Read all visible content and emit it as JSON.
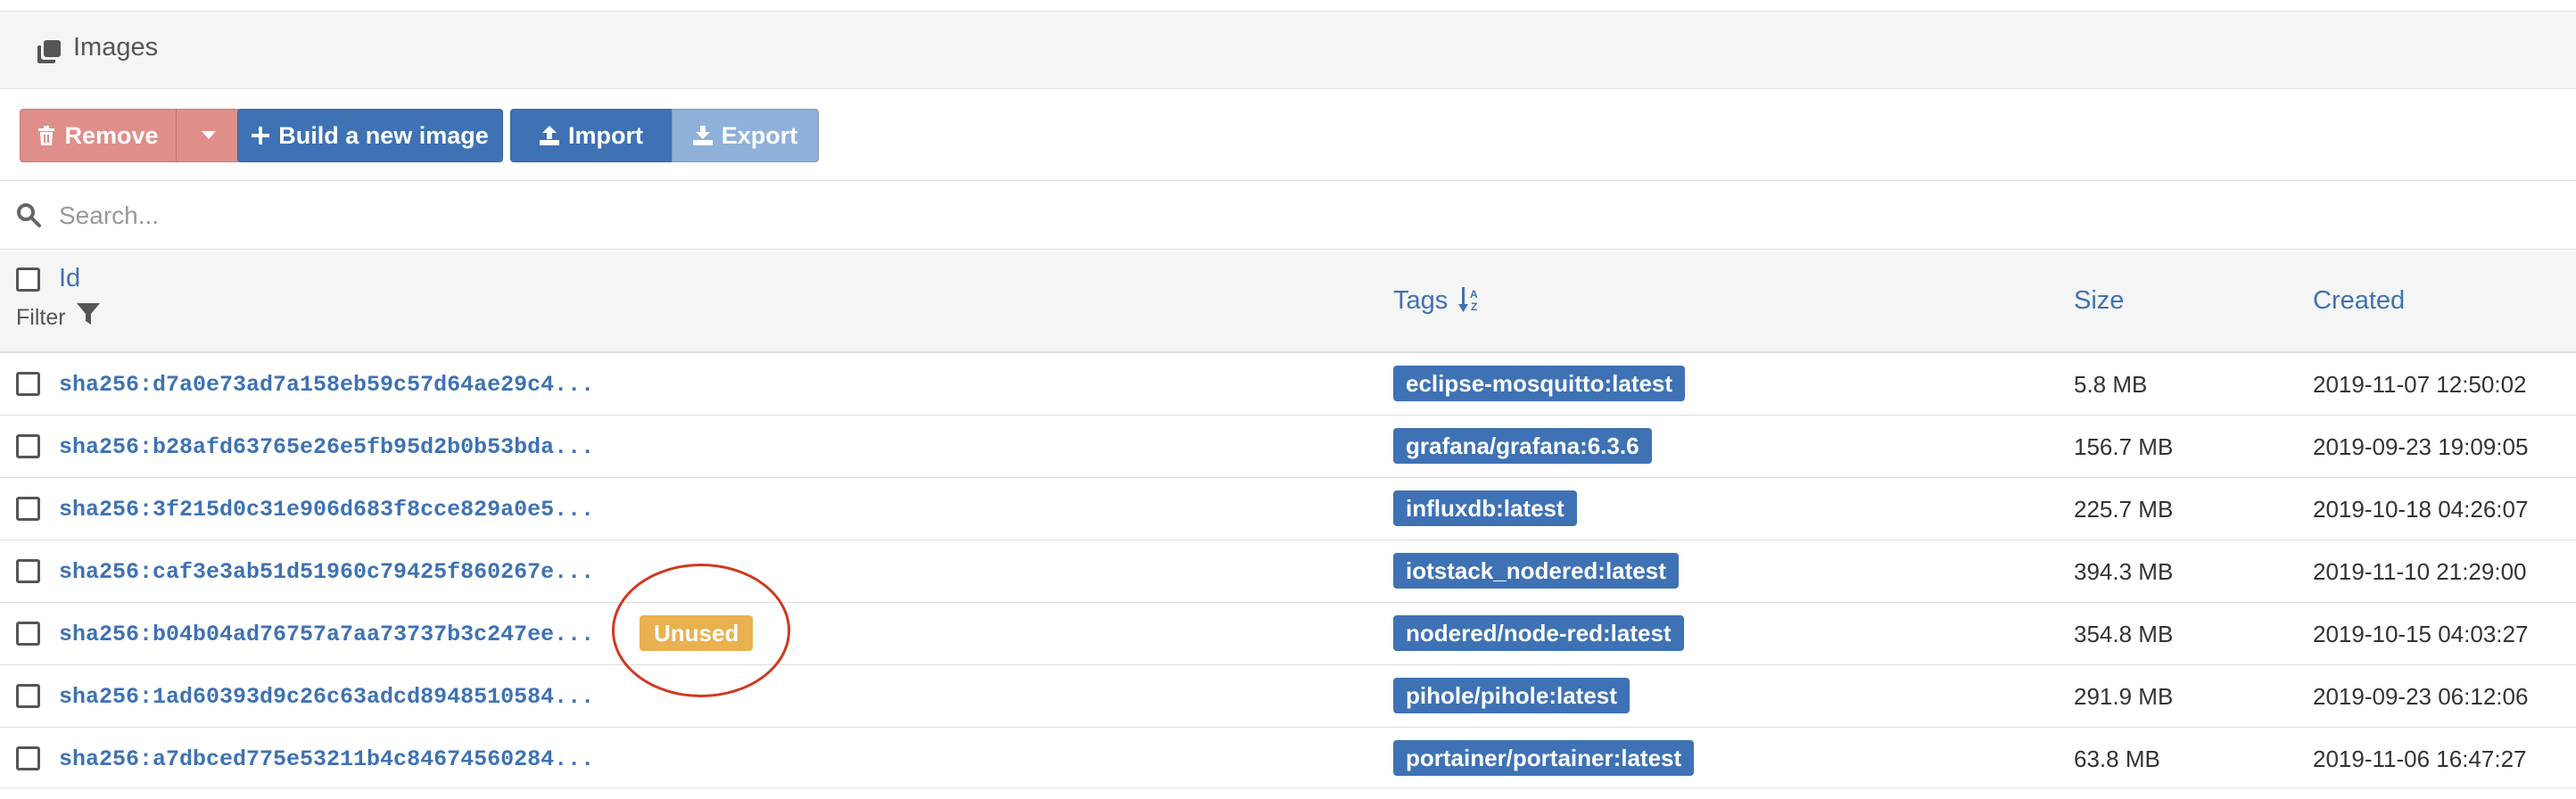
{
  "panel": {
    "title": "Images",
    "title_icon": "clone-icon"
  },
  "toolbar": {
    "remove_label": "Remove",
    "build_label": "Build a new image",
    "import_label": "Import",
    "export_label": "Export"
  },
  "search": {
    "placeholder": "Search...",
    "value": ""
  },
  "table": {
    "headers": {
      "id": "Id",
      "filter": "Filter",
      "tags": "Tags",
      "size": "Size",
      "created": "Created"
    },
    "rows": [
      {
        "id": "sha256:d7a0e73ad7a158eb59c57d64ae29c4...",
        "tag": "eclipse-mosquitto:latest",
        "size": "5.8 MB",
        "created": "2019-11-07 12:50:02",
        "badge": ""
      },
      {
        "id": "sha256:b28afd63765e26e5fb95d2b0b53bda...",
        "tag": "grafana/grafana:6.3.6",
        "size": "156.7 MB",
        "created": "2019-09-23 19:09:05",
        "badge": ""
      },
      {
        "id": "sha256:3f215d0c31e906d683f8cce829a0e5...",
        "tag": "influxdb:latest",
        "size": "225.7 MB",
        "created": "2019-10-18 04:26:07",
        "badge": ""
      },
      {
        "id": "sha256:caf3e3ab51d51960c79425f860267e...",
        "tag": "iotstack_nodered:latest",
        "size": "394.3 MB",
        "created": "2019-11-10 21:29:00",
        "badge": ""
      },
      {
        "id": "sha256:b04b04ad76757a7aa73737b3c247ee...",
        "tag": "nodered/node-red:latest",
        "size": "354.8 MB",
        "created": "2019-10-15 04:03:27",
        "badge": "Unused"
      },
      {
        "id": "sha256:1ad60393d9c26c63adcd8948510584...",
        "tag": "pihole/pihole:latest",
        "size": "291.9 MB",
        "created": "2019-09-23 06:12:06",
        "badge": ""
      },
      {
        "id": "sha256:a7dbced775e53211b4c84674560284...",
        "tag": "portainer/portainer:latest",
        "size": "63.8 MB",
        "created": "2019-11-06 16:47:27",
        "badge": ""
      }
    ]
  },
  "colors": {
    "primary": "#3e72b4",
    "danger": "#e08e89",
    "warning": "#e9b14f",
    "annotation": "#d0381f"
  }
}
